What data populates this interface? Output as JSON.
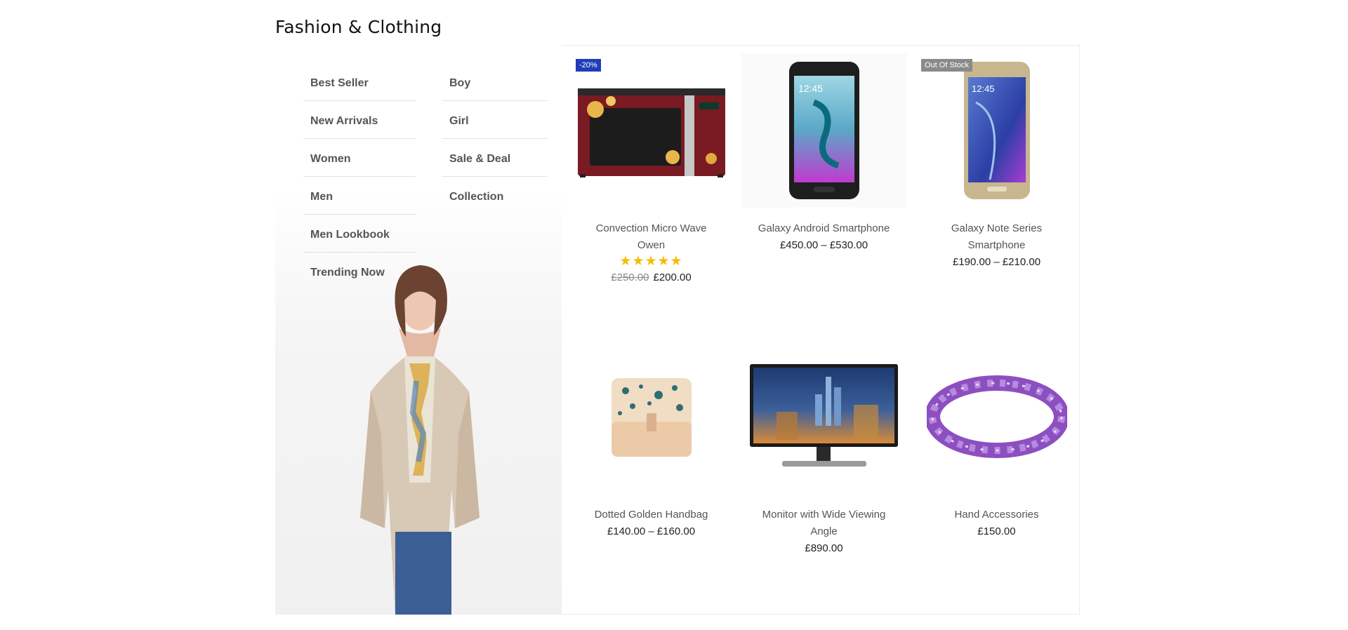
{
  "section": {
    "title": "Fashion & Clothing"
  },
  "menu": {
    "col1": [
      "Best Seller",
      "New Arrivals",
      "Women",
      "Men",
      "Men Lookbook",
      "Trending Now"
    ],
    "col2": [
      "Boy",
      "Girl",
      "Sale & Deal",
      "Collection"
    ]
  },
  "products": [
    {
      "name": "Convection Micro Wave Owen",
      "badge": "-20%",
      "stars": "★★★★★",
      "old_price": "£250.00",
      "price": "£200.00",
      "rating": 5
    },
    {
      "name": "Galaxy Android Smartphone",
      "price": "£450.00 – £530.00"
    },
    {
      "name": "Galaxy Note Series Smartphone",
      "badge": "Out Of Stock",
      "price": "£190.00 – £210.00"
    },
    {
      "name": "Dotted Golden Handbag",
      "price": "£140.00 – £160.00"
    },
    {
      "name": "Monitor with Wide Viewing Angle",
      "price": "£890.00"
    },
    {
      "name": "Hand Accessories",
      "price": "£150.00"
    }
  ],
  "colors": {
    "sale_badge": "#1e3eb8",
    "oos_badge": "#8a8a8a",
    "stars": "#f5bd00"
  }
}
